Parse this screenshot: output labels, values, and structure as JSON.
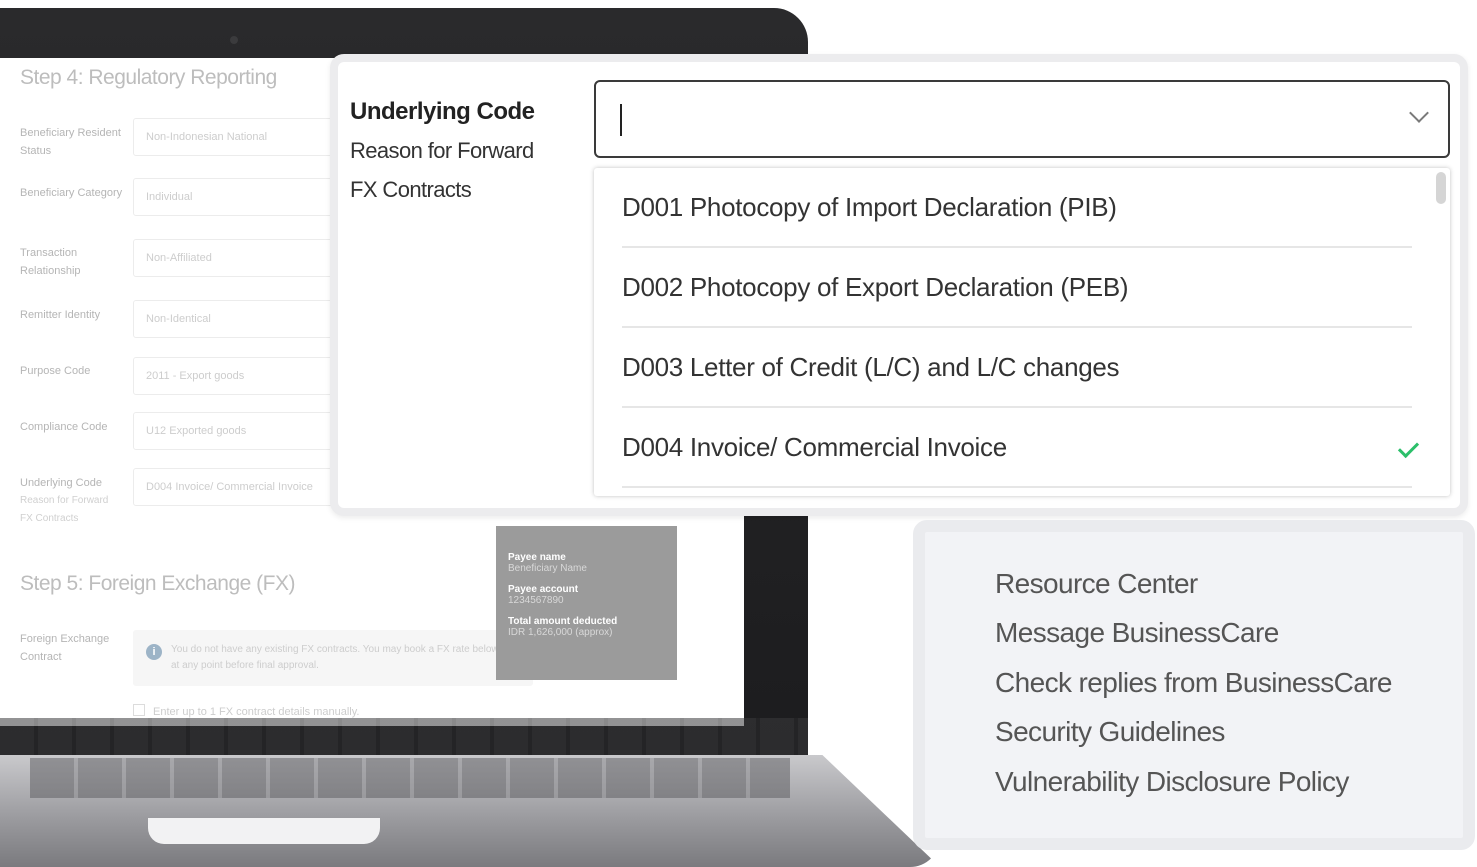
{
  "background_form": {
    "step4_title": "Step 4: Regulatory Reporting",
    "fields": [
      {
        "label": "Beneficiary Resident Status",
        "value": "Non-Indonesian National"
      },
      {
        "label": "Beneficiary Category",
        "value": "Individual"
      },
      {
        "label": "Transaction Relationship",
        "value": "Non-Affiliated"
      },
      {
        "label": "Remitter Identity",
        "value": "Non-Identical"
      },
      {
        "label": "Purpose Code",
        "value": "2011 - Export goods"
      },
      {
        "label": "Compliance Code",
        "value": "U12 Exported goods"
      },
      {
        "label": "Underlying Code",
        "sub1": "Reason for Forward",
        "sub2": "FX Contracts",
        "value": "D004 Invoice/ Commercial Invoice"
      }
    ],
    "step5_title": "Step 5: Foreign Exchange (FX)",
    "fx_label": "Foreign Exchange Contract",
    "fx_info": "You do not have any existing FX contracts. You may book a FX rate below or at any point before final approval.",
    "fx_checkbox": "Enter up to 1 FX contract details manually.",
    "summary": {
      "payee_name_label": "Payee name",
      "payee_name": "Beneficiary Name",
      "payee_account_label": "Payee account",
      "payee_account": "1234567890",
      "total_label": "Total amount deducted",
      "total_value": "IDR 1,626,000 (approx)"
    }
  },
  "underlying_panel": {
    "label_main": "Underlying Code",
    "label_sub1": "Reason for Forward",
    "label_sub2": "FX Contracts",
    "select_value": "",
    "options": [
      {
        "label": "D001 Photocopy of Import Declaration (PIB)",
        "selected": false
      },
      {
        "label": "D002 Photocopy of Export Declaration (PEB)",
        "selected": false
      },
      {
        "label": "D003 Letter of Credit (L/C) and L/C changes",
        "selected": false
      },
      {
        "label": "D004 Invoice/ Commercial Invoice",
        "selected": true
      }
    ],
    "check_color": "#2bbf6a"
  },
  "footer_links": [
    "Resource Center",
    "Message BusinessCare",
    "Check replies from BusinessCare",
    "Security Guidelines",
    "Vulnerability Disclosure Policy"
  ]
}
